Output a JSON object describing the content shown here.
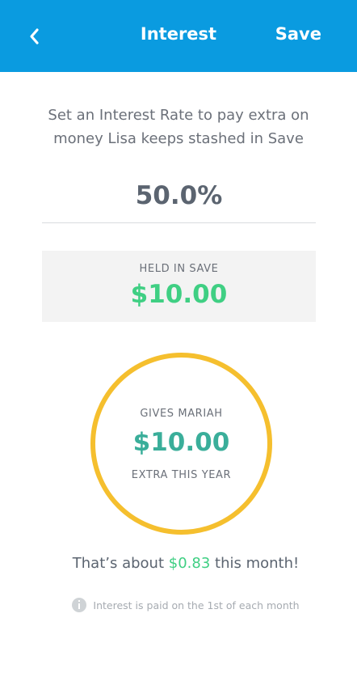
{
  "header": {
    "title": "Interest",
    "save_label": "Save",
    "background": "#0a9be0",
    "back_icon": "chevron-left-icon"
  },
  "intro": {
    "text": "Set an Interest Rate to pay extra on money Lisa keeps stashed in Save"
  },
  "rate": {
    "value": "50.0%"
  },
  "held": {
    "label": "HELD IN SAVE",
    "value": "$10.00",
    "value_color": "#3fcf83"
  },
  "gives": {
    "label": "GIVES MARIAH",
    "value": "$10.00",
    "sub_label": "EXTRA THIS YEAR",
    "ring_color": "#f5bf2e",
    "value_color": "#3aae9a"
  },
  "monthly": {
    "prefix": "That’s about",
    "amount": "$0.83",
    "suffix": "this month!"
  },
  "note": {
    "text": "Interest is paid on the 1st of each month",
    "icon": "info-icon"
  }
}
